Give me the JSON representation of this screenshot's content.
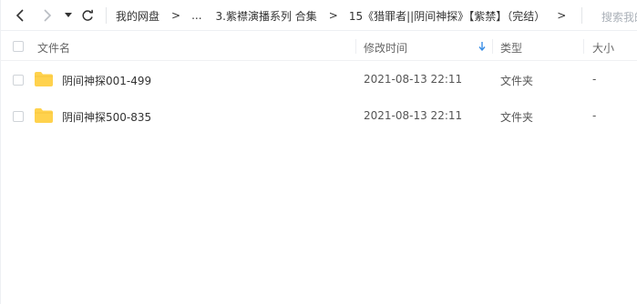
{
  "toolbar": {
    "breadcrumbs": [
      "我的网盘",
      "...",
      "3.紫襟演播系列 合集",
      "15《猎罪者||阴间神探》【紫禁】（完结）"
    ],
    "arrow": ">",
    "search_placeholder": "搜索我的"
  },
  "header": {
    "name": "文件名",
    "modified": "修改时间",
    "type": "类型",
    "size": "大小"
  },
  "rows": [
    {
      "name": "阴间神探001-499",
      "modified": "2021-08-13 22:11",
      "type": "文件夹",
      "size": "-"
    },
    {
      "name": "阴间神探500-835",
      "modified": "2021-08-13 22:11",
      "type": "文件夹",
      "size": "-"
    }
  ],
  "colors": {
    "folder": "#ffd24d",
    "sort_arrow": "#3a8ee6"
  }
}
